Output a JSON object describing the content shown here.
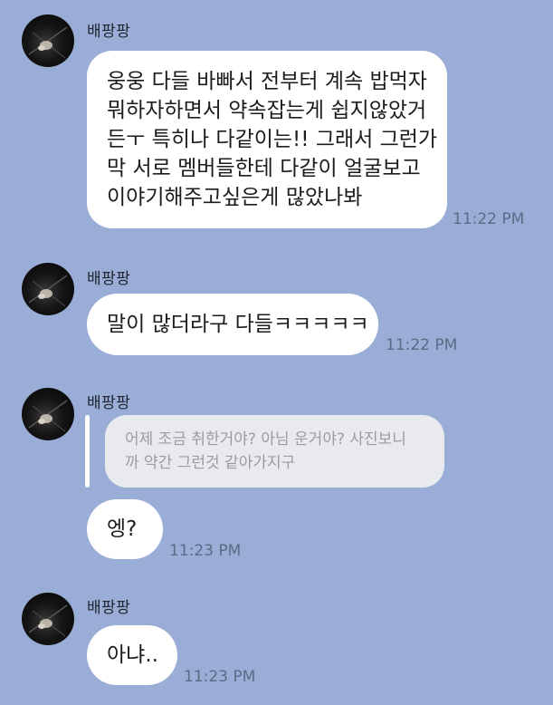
{
  "chat": {
    "messages": [
      {
        "sender": "배팡팡",
        "lines": [
          "웅웅 다들 바빠서 전부터 계속 밥먹자",
          "뭐하자하면서 약속잡는게 쉽지않았거",
          "든ㅜ 특히나 다같이는!! 그래서 그런가",
          "막 서로 멤버들한테 다같이 얼굴보고",
          "이야기해주고싶은게 많았나봐"
        ],
        "time": "11:22 PM"
      },
      {
        "sender": "배팡팡",
        "lines": [
          "말이 많더라구 다들ㅋㅋㅋㅋㅋ"
        ],
        "time": "11:22 PM"
      },
      {
        "sender": "배팡팡",
        "quote_lines": [
          "어제 조금 취한거야? 아님 운거야? 사진보니",
          "까 약간 그런것 같아가지구"
        ],
        "lines": [
          "엥?"
        ],
        "time": "11:23 PM"
      },
      {
        "sender": "배팡팡",
        "lines": [
          "아냐.."
        ],
        "time": "11:23 PM"
      }
    ]
  },
  "colors": {
    "background": "#9aadd6",
    "bubble": "#ffffff",
    "quote_bubble": "#e9eaee",
    "time_text": "#5c6b85"
  }
}
